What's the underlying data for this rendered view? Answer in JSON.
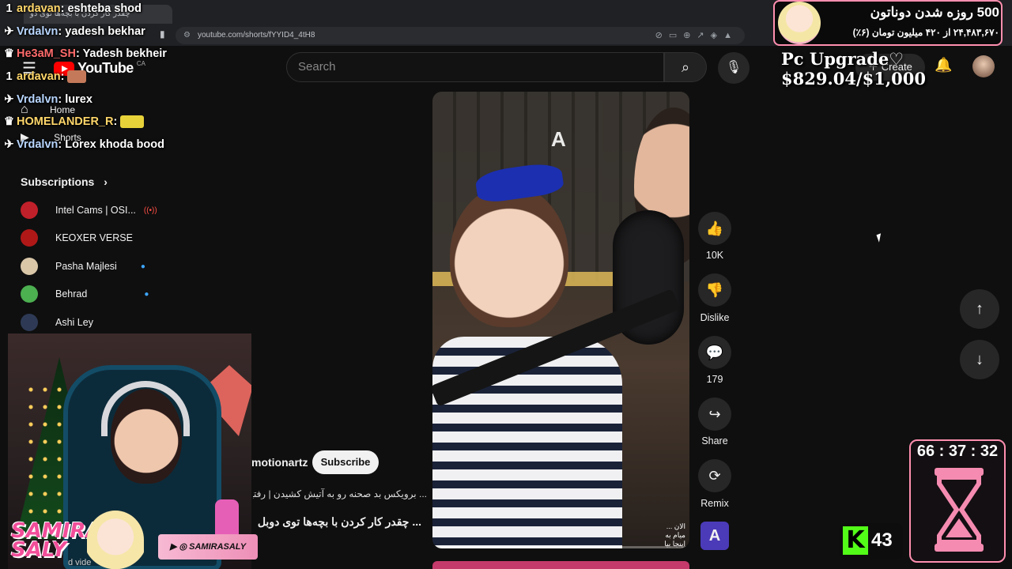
{
  "browser": {
    "tab_title": "چقدر کار کردن با بچه‌ها توی دو",
    "url": "youtube.com/shorts/fYYID4_4tH8"
  },
  "header": {
    "logo_text": "YouTube",
    "logo_region": "CA",
    "search_placeholder": "Search",
    "create_label": "Create"
  },
  "sidebar": {
    "home_label": "Home",
    "shorts_label": "Shorts",
    "subscriptions_title": "Subscriptions",
    "subscriptions": [
      {
        "name": "Intel Cams | OSI...",
        "status": "live",
        "avatar_color": "#c0202a"
      },
      {
        "name": "KEOXER VERSE",
        "status": "",
        "avatar_color": "#b01818"
      },
      {
        "name": "Pasha Majlesi",
        "status": "new",
        "avatar_color": "#d9c7a8"
      },
      {
        "name": "Behrad",
        "status": "new",
        "avatar_color": "#4caf50"
      },
      {
        "name": "Ashi Ley",
        "status": "",
        "avatar_color": "#2e3a55"
      }
    ]
  },
  "chat": [
    {
      "badge": "1",
      "user": "ardavan",
      "text": "eshteba shod",
      "color": "gold"
    },
    {
      "badge": "✈",
      "user": "Vrdalvn",
      "text": "yadesh bekhar",
      "color": "blue"
    },
    {
      "badge": "♛",
      "user": "He3aM_SH",
      "text": "Yadesh bekheir",
      "color": "red"
    },
    {
      "badge": "1",
      "user": "ardavan",
      "text": "",
      "color": "gold",
      "emote": true
    },
    {
      "badge": "✈",
      "user": "Vrdalvn",
      "text": "lurex",
      "color": "blue"
    },
    {
      "badge": "♛",
      "user": "HOMELANDER_R",
      "text": "",
      "color": "gold",
      "emote": true
    },
    {
      "badge": "✈",
      "user": "Vrdalvn",
      "text": "Lorex khoda bood",
      "color": "blue"
    }
  ],
  "video": {
    "watermark": "A",
    "channel": "motionartz",
    "subscribe_label": "Subscribe",
    "description": "... برویکس بد صحنه رو به آتیش کشیدن | رفتیم",
    "title": "... چقدر کار کردن با بچه‌ها توی دوبل",
    "caption": "... الان میام به اینجا بیا"
  },
  "actions": {
    "like_count": "10K",
    "dislike_label": "Dislike",
    "comment_count": "179",
    "share_label": "Share",
    "remix_label": "Remix"
  },
  "overlay": {
    "goal_title": "500 روزه شدن دوناتون",
    "goal_sub": "۲۴,۴۸۳,۶۷۰ از ۴۲۰ میلیون تومان (۶٪)",
    "upgrade_text": "Pc Upgrade♡ $829.04/$1,000",
    "timer": "66 : 37 : 32",
    "kick_count": "43",
    "social_handle": "SAMIRASALY",
    "streamer_logo_line1": "SAMIRA",
    "streamer_logo_line2": "SALY",
    "partial_label": "d vide"
  }
}
